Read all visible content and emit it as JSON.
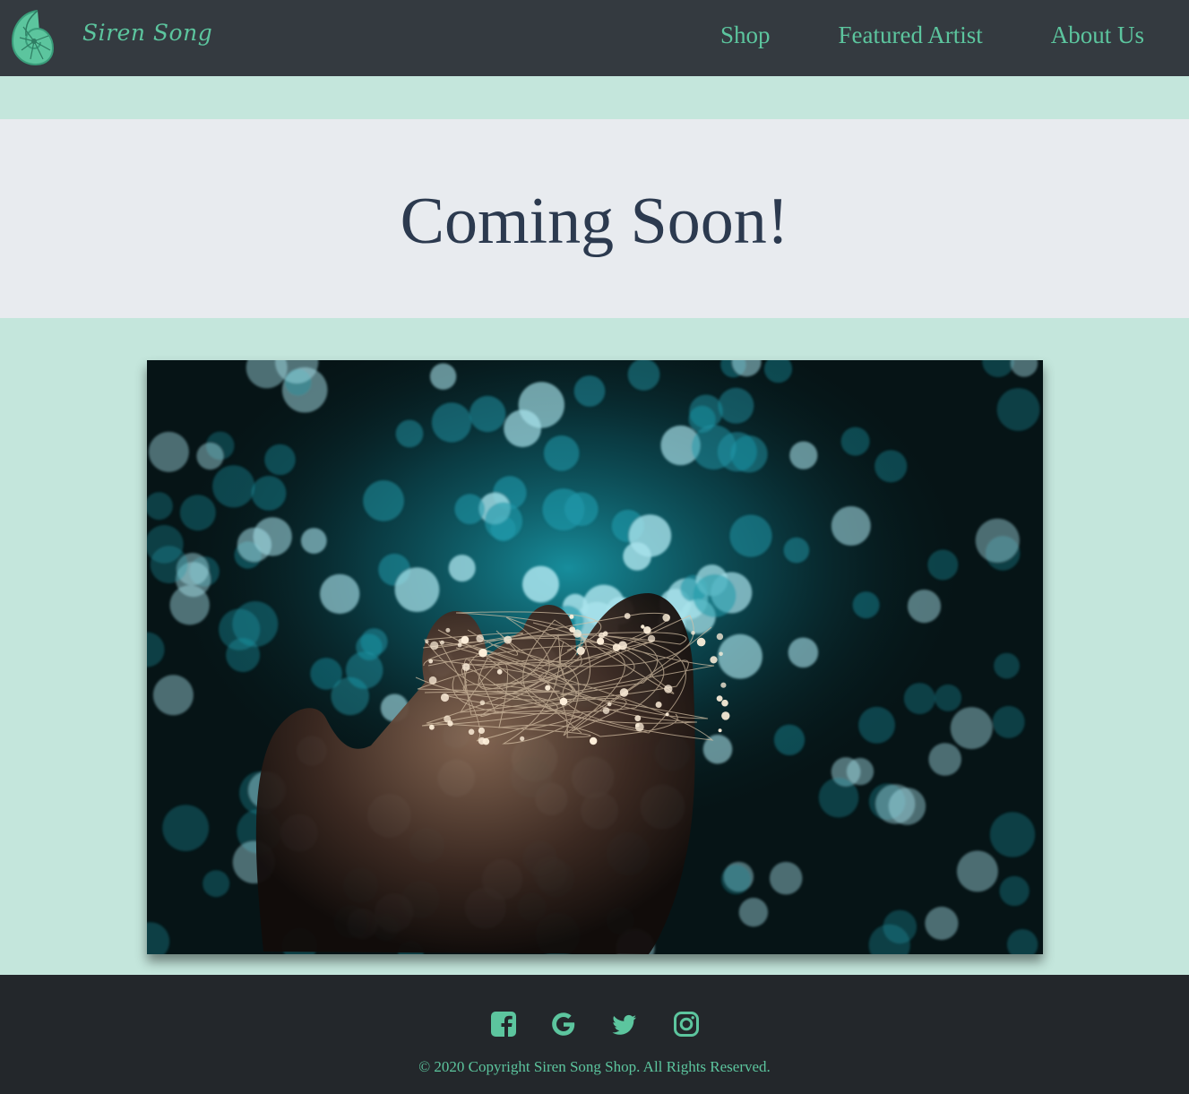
{
  "nav": {
    "brand": "Siren Song",
    "logo_icon": "nautilus-shell-icon",
    "links": [
      "Shop",
      "Featured Artist",
      "About Us"
    ]
  },
  "hero": {
    "title": "Coming Soon!"
  },
  "photo": {
    "subject": "hand-holding-fairy-lights-photo"
  },
  "footer": {
    "social_icons": [
      "facebook-icon",
      "google-icon",
      "twitter-icon",
      "instagram-icon"
    ],
    "copyright": "© 2020 Copyright Siren Song Shop. All Rights Reserved."
  },
  "colors": {
    "accent": "#5cc59e",
    "nav_bg": "#343a40",
    "page_bg": "#c4e6dc",
    "hero_bg": "#e8ebef",
    "title_text": "#2c3a4f",
    "footer_bg": "#23272b"
  }
}
